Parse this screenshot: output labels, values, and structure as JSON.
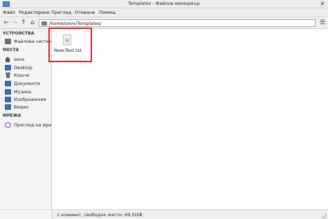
{
  "window": {
    "title": "Templates - Файлов мениджър",
    "close_symbol": "×"
  },
  "menu": {
    "items": [
      "Файл",
      "Редактиране",
      "Преглед",
      "Отиване",
      "Помощ"
    ]
  },
  "toolbar": {
    "back_symbol": "←",
    "forward_symbol": "→",
    "up_symbol": "↑",
    "home_symbol": "⌂",
    "path": "/home/sevo/Templates/",
    "menu_symbol": "☰"
  },
  "sidebar": {
    "devices_header": "УСТРОЙСТВА",
    "devices": [
      {
        "label": "Файлова система",
        "icon": "drive-icon"
      }
    ],
    "places_header": "МЕСТА",
    "places": [
      {
        "label": "sevo",
        "icon": "home-icon"
      },
      {
        "label": "Desktop",
        "icon": "folder-icon"
      },
      {
        "label": "Кошче",
        "icon": "trash-icon"
      },
      {
        "label": "Документи",
        "icon": "folder-icon"
      },
      {
        "label": "Музика",
        "icon": "folder-icon"
      },
      {
        "label": "Изображения",
        "icon": "folder-icon"
      },
      {
        "label": "Видео",
        "icon": "folder-icon"
      }
    ],
    "network_header": "МРЕЖА",
    "network": [
      {
        "label": "Преглед на мрежата",
        "icon": "network-icon"
      }
    ]
  },
  "files": [
    {
      "name": "New-Text.txt",
      "icon": "text-file-icon"
    }
  ],
  "status": {
    "text": "1 елемент, свободно място: 69,3GiB"
  },
  "colors": {
    "highlight": "#d81f26",
    "folder": "#3b6fb6"
  }
}
